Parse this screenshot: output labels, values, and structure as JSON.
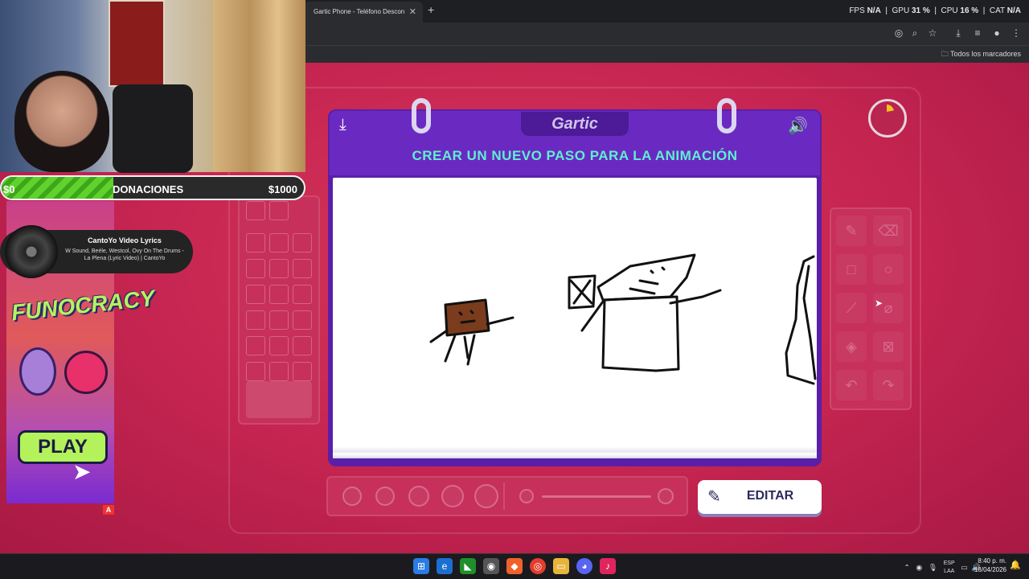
{
  "browser": {
    "tab_title": "Gartic Phone - Teléfono Descon",
    "tab_close": "✕",
    "new_tab": "+",
    "perf": {
      "fps_label": "FPS",
      "fps_val": "N/A",
      "gpu_label": "GPU",
      "gpu_val": "31 %",
      "cpu_label": "CPU",
      "cpu_val": "16 %",
      "cat_label": "CAT",
      "cat_val": "N/A"
    },
    "bookmarks_label": "Todos los marcadores"
  },
  "overlay": {
    "donation_min": "$0",
    "donation_label": "DONACIONES",
    "donation_max": "$1000",
    "donation_progress_fraction": 0.37,
    "music_title": "CantoYo Video Lyrics",
    "music_subtitle": "W Sound, Beéle, Westcol, Ovy On The Drums - La Plena (Lyric Video) | CantoYo",
    "promo_logo": "FUNOCRACY",
    "promo_play": "PLAY",
    "badge": "A"
  },
  "game": {
    "logo": "Gartic",
    "headline": "CREAR UN NUEVO PASO PARA LA ANIMACIÓN",
    "edit_button": "EDITAR",
    "accent": "#5ff0d0",
    "header_color": "#6a2ac2"
  },
  "taskbar": {
    "lang": "ESP",
    "lang2": "LAA",
    "time": "8:40 p. m.",
    "date": "18/04/2026"
  }
}
